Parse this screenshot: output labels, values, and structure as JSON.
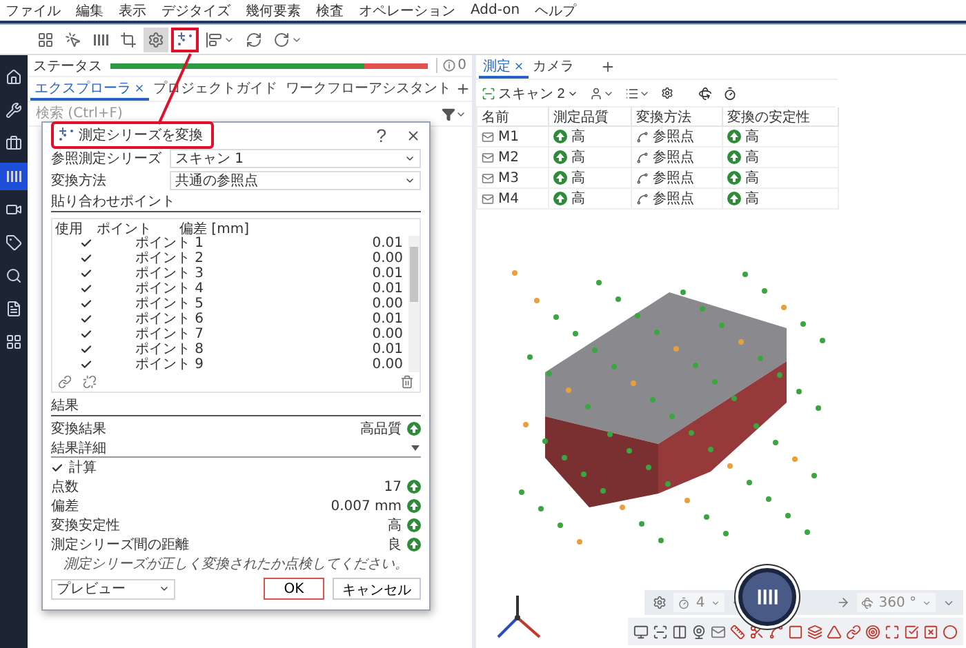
{
  "menu": [
    "ファイル",
    "編集",
    "表示",
    "デジタイズ",
    "幾何要素",
    "検査",
    "オペレーション",
    "Add-on",
    "ヘルプ"
  ],
  "toolbar": [
    {
      "kind": "grid",
      "selected": false,
      "highlighted": false,
      "caret": false
    },
    {
      "kind": "pointer",
      "selected": false,
      "highlighted": false,
      "caret": false
    },
    {
      "kind": "bars",
      "selected": false,
      "highlighted": false,
      "caret": false
    },
    {
      "kind": "crop",
      "selected": false,
      "highlighted": false,
      "caret": false
    },
    {
      "kind": "settings",
      "selected": true,
      "highlighted": false,
      "caret": false
    },
    {
      "kind": "scatter",
      "selected": false,
      "highlighted": true,
      "caret": false
    },
    {
      "kind": "align",
      "selected": false,
      "highlighted": false,
      "caret": true
    },
    {
      "kind": "refresh",
      "selected": false,
      "highlighted": false,
      "caret": false
    },
    {
      "kind": "redo",
      "selected": false,
      "highlighted": false,
      "caret": true
    }
  ],
  "sidebar": [
    {
      "kind": "home",
      "selected": false
    },
    {
      "kind": "wrench",
      "selected": false
    },
    {
      "kind": "toolbox",
      "selected": false
    },
    {
      "kind": "bars",
      "selected": true
    },
    {
      "kind": "video",
      "selected": false
    },
    {
      "kind": "tag",
      "selected": false
    },
    {
      "kind": "search",
      "selected": false
    },
    {
      "kind": "document",
      "selected": false
    },
    {
      "kind": "grid",
      "selected": false
    }
  ],
  "status": {
    "label": "ステータス",
    "level": 0.8,
    "count": "0"
  },
  "explorer_tabs": [
    {
      "label": "エクスプローラ",
      "selected": true,
      "closable": true
    },
    {
      "label": "プロジェクトガイド",
      "selected": false,
      "closable": false
    },
    {
      "label": "ワークフローアシスタント",
      "selected": false,
      "closable": false
    }
  ],
  "search": {
    "placeholder": "検索 (Ctrl+F)"
  },
  "dialog": {
    "title": "測定シリーズを変換",
    "highlighted": true,
    "help": "?",
    "fields": [
      {
        "label": "参照測定シリーズ",
        "value": "スキャン 1"
      },
      {
        "label": "変換方法",
        "value": "共通の参照点"
      }
    ],
    "points_heading": "貼り合わせポイント",
    "point_columns": [
      "使用",
      "ポイント",
      "偏差 [mm]"
    ],
    "points": [
      {
        "name": "ポイント 1",
        "deviation": "0.01",
        "checked": true
      },
      {
        "name": "ポイント 2",
        "deviation": "0.00",
        "checked": true
      },
      {
        "name": "ポイント 3",
        "deviation": "0.01",
        "checked": true
      },
      {
        "name": "ポイント 4",
        "deviation": "0.01",
        "checked": true
      },
      {
        "name": "ポイント 5",
        "deviation": "0.00",
        "checked": true
      },
      {
        "name": "ポイント 6",
        "deviation": "0.01",
        "checked": true
      },
      {
        "name": "ポイント 7",
        "deviation": "0.00",
        "checked": true
      },
      {
        "name": "ポイント 8",
        "deviation": "0.01",
        "checked": true
      },
      {
        "name": "ポイント 9",
        "deviation": "0.00",
        "checked": true
      }
    ],
    "results_heading": "結果",
    "result": {
      "label": "変換結果",
      "value": "高品質"
    },
    "details": {
      "label": "結果詳細",
      "expanded": true
    },
    "calculate": {
      "label": "計算",
      "checked": true
    },
    "details_rows": [
      {
        "label": "点数",
        "value": "17"
      },
      {
        "label": "偏差",
        "value": "0.007 mm"
      },
      {
        "label": "変換安定性",
        "value": "高"
      },
      {
        "label": "測定シリーズ間の距離",
        "value": "良"
      }
    ],
    "message": "測定シリーズが正しく変換されたか点検してください。",
    "preview": "プレビュー",
    "buttons": [
      {
        "label": "OK",
        "focused": true
      },
      {
        "label": "キャンセル",
        "focused": false
      }
    ]
  },
  "view_tabs": [
    {
      "label": "測定",
      "selected": true,
      "closable": true
    },
    {
      "label": "カメラ",
      "selected": false,
      "closable": false
    }
  ],
  "view_toolbar": {
    "series": "スキャン 2"
  },
  "table": {
    "columns": [
      "名前",
      "測定品質",
      "変換方法",
      "変換の安定性"
    ],
    "rows": [
      {
        "name": "M1",
        "quality": "高",
        "method": "参照点",
        "stability": "高"
      },
      {
        "name": "M2",
        "quality": "高",
        "method": "参照点",
        "stability": "高"
      },
      {
        "name": "M3",
        "quality": "高",
        "method": "参照点",
        "stability": "高"
      },
      {
        "name": "M4",
        "quality": "高",
        "method": "参照点",
        "stability": "高"
      }
    ]
  },
  "viewport": {
    "count": "4",
    "angle": "360 °"
  }
}
